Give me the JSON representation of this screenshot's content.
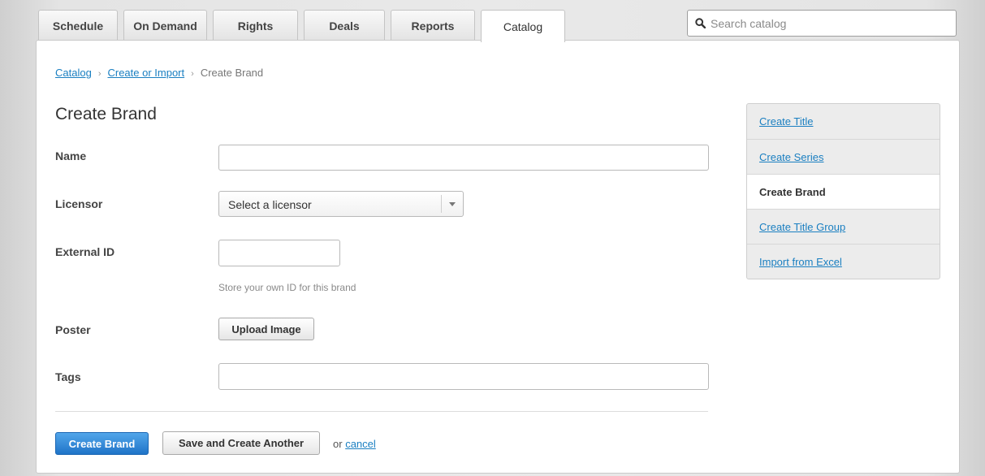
{
  "tabs": [
    {
      "label": "Schedule",
      "active": false
    },
    {
      "label": "On Demand",
      "active": false
    },
    {
      "label": "Rights",
      "active": false
    },
    {
      "label": "Deals",
      "active": false
    },
    {
      "label": "Reports",
      "active": false
    },
    {
      "label": "Catalog",
      "active": true
    }
  ],
  "search": {
    "placeholder": "Search catalog",
    "value": ""
  },
  "breadcrumb": [
    {
      "label": "Catalog",
      "link": true
    },
    {
      "label": "Create or Import",
      "link": true
    },
    {
      "label": "Create Brand",
      "link": false
    }
  ],
  "breadcrumb_separator": "›",
  "page_title": "Create Brand",
  "form": {
    "name_label": "Name",
    "name_value": "",
    "licensor_label": "Licensor",
    "licensor_selected": "Select a licensor",
    "external_id_label": "External ID",
    "external_id_value": "",
    "external_id_help": "Store your own ID for this brand",
    "poster_label": "Poster",
    "upload_button": "Upload Image",
    "tags_label": "Tags",
    "tags_value": ""
  },
  "actions": {
    "primary": "Create Brand",
    "secondary": "Save and Create Another",
    "or_text": "or",
    "cancel": "cancel"
  },
  "sidenav": [
    {
      "label": "Create Title",
      "active": false
    },
    {
      "label": "Create Series",
      "active": false
    },
    {
      "label": "Create Brand",
      "active": true
    },
    {
      "label": "Create Title Group",
      "active": false
    },
    {
      "label": "Import from Excel",
      "active": false
    }
  ],
  "colors": {
    "link": "#1a7fc1",
    "primary_button": "#2a82d4"
  },
  "icons": {
    "search": "search-icon",
    "dropdown": "chevron-down-icon"
  }
}
